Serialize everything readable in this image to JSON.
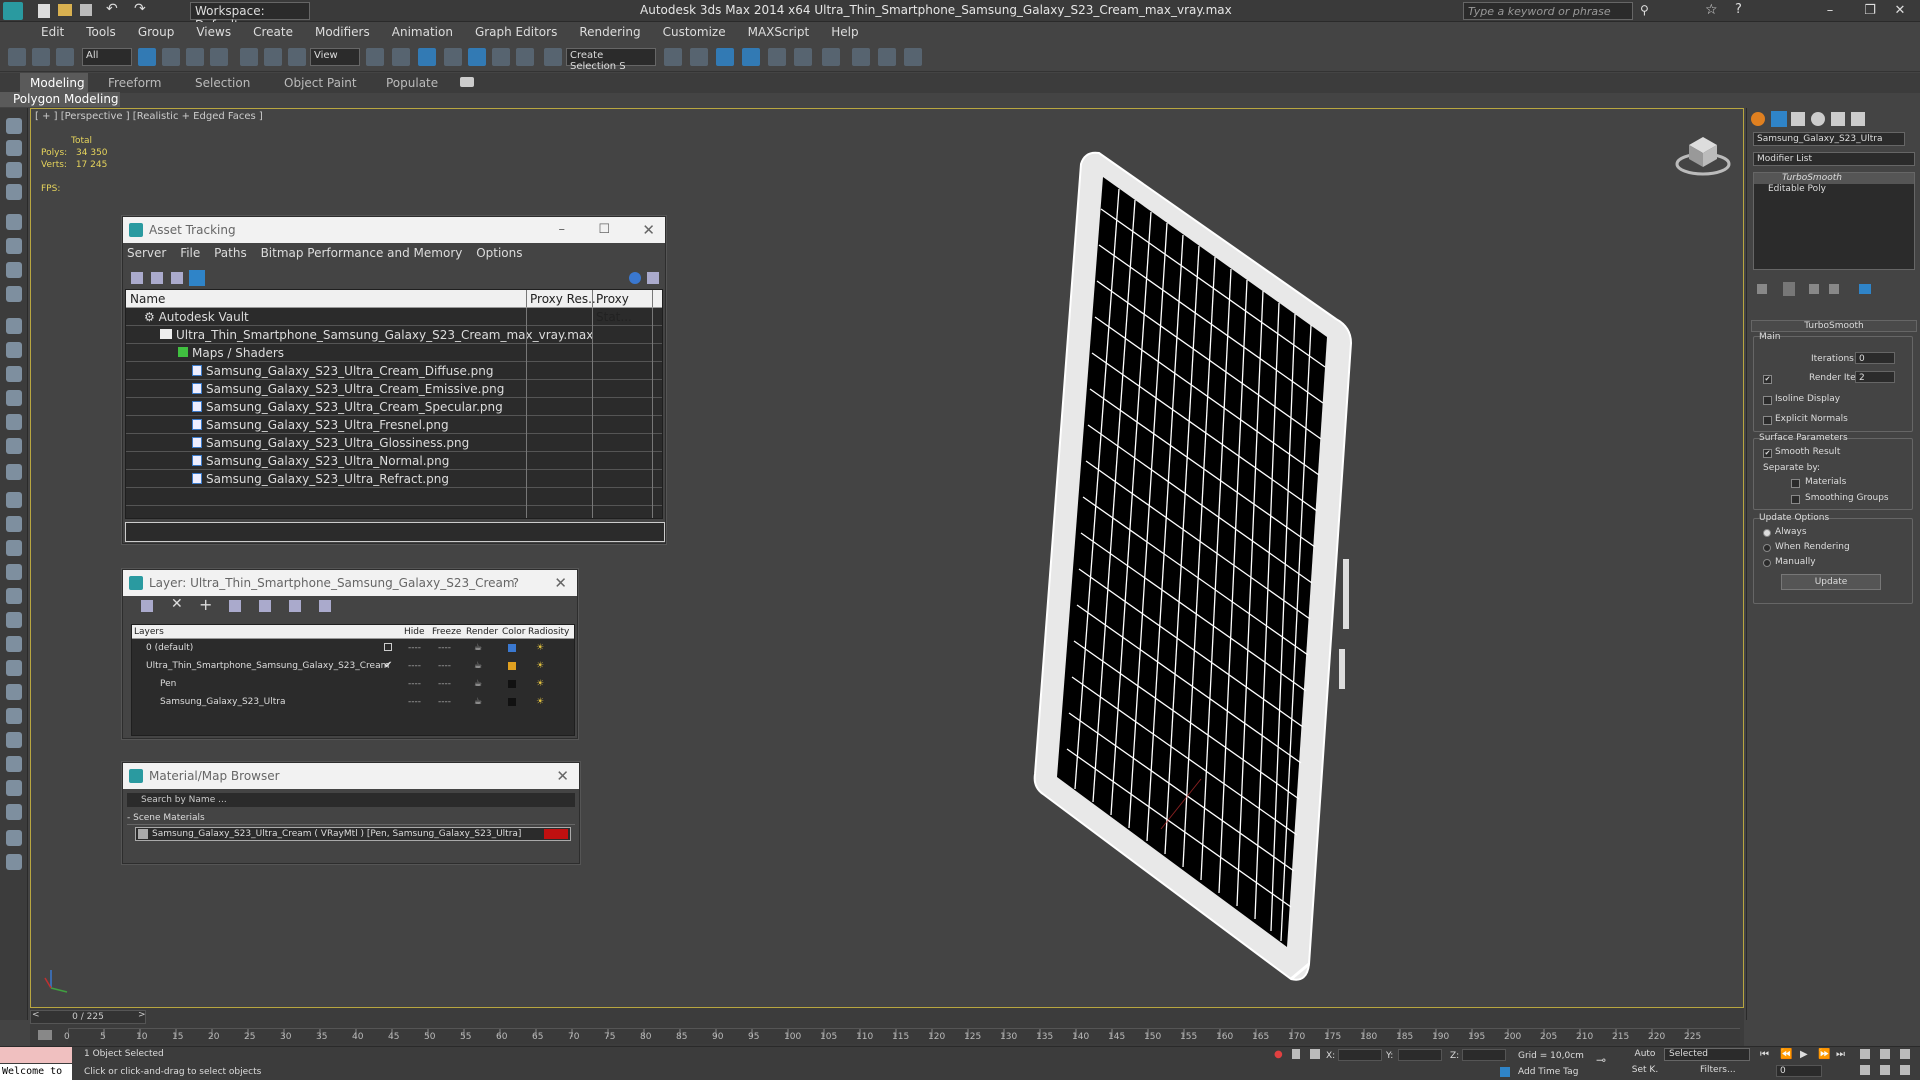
{
  "app": {
    "title": "Autodesk 3ds Max  2014 x64     Ultra_Thin_Smartphone_Samsung_Galaxy_S23_Cream_max_vray.max",
    "workspace": "Workspace: Default",
    "search_placeholder": "Type a keyword or phrase"
  },
  "menu": [
    "Edit",
    "Tools",
    "Group",
    "Views",
    "Create",
    "Modifiers",
    "Animation",
    "Graph Editors",
    "Rendering",
    "Customize",
    "MAXScript",
    "Help"
  ],
  "toolbar": {
    "filter": "All",
    "view": "View",
    "selset": "Create Selection S"
  },
  "ribbon": {
    "tabs": [
      "Modeling",
      "Freeform",
      "Selection",
      "Object Paint",
      "Populate"
    ],
    "sub": "Polygon Modeling"
  },
  "viewport": {
    "label": "[ + ] [Perspective ] [Realistic + Edged Faces ]",
    "stats": {
      "total": "Total",
      "polys_label": "Polys:",
      "polys": "34 350",
      "verts_label": "Verts:",
      "verts": "17 245",
      "fps": "FPS:"
    }
  },
  "asset_tracking": {
    "title": "Asset Tracking",
    "menu": [
      "Server",
      "File",
      "Paths",
      "Bitmap Performance and Memory",
      "Options"
    ],
    "columns": [
      "Name",
      "Proxy Res...",
      "Proxy Stat..."
    ],
    "vault": "Autodesk Vault",
    "maxfile": "Ultra_Thin_Smartphone_Samsung_Galaxy_S23_Cream_max_vray.max",
    "maps": "Maps / Shaders",
    "files": [
      "Samsung_Galaxy_S23_Ultra_Cream_Diffuse.png",
      "Samsung_Galaxy_S23_Ultra_Cream_Emissive.png",
      "Samsung_Galaxy_S23_Ultra_Cream_Specular.png",
      "Samsung_Galaxy_S23_Ultra_Fresnel.png",
      "Samsung_Galaxy_S23_Ultra_Glossiness.png",
      "Samsung_Galaxy_S23_Ultra_Normal.png",
      "Samsung_Galaxy_S23_Ultra_Refract.png"
    ]
  },
  "layer": {
    "title": "Layer: Ultra_Thin_Smartphone_Samsung_Galaxy_S23_Cream",
    "help": "?",
    "columns": [
      "Layers",
      "Hide",
      "Freeze",
      "Render",
      "Color",
      "Radiosity"
    ],
    "rows": [
      {
        "name": "0 (default)",
        "color": "#3a78d0"
      },
      {
        "name": "Ultra_Thin_Smartphone_Samsung_Galaxy_S23_Cream",
        "color": "#e0a020"
      },
      {
        "name": "Pen",
        "color": "#111111"
      },
      {
        "name": "Samsung_Galaxy_S23_Ultra",
        "color": "#111111"
      }
    ]
  },
  "material_browser": {
    "title": "Material/Map Browser",
    "search": "Search by Name ...",
    "section": "- Scene Materials",
    "item": "Samsung_Galaxy_S23_Ultra_Cream  ( VRayMtl )  [Pen, Samsung_Galaxy_S23_Ultra]"
  },
  "command_panel": {
    "object_name": "Samsung_Galaxy_S23_Ultra",
    "modifier_list": "Modifier List",
    "stack": [
      "TurboSmooth",
      "Editable Poly"
    ],
    "rollout": "TurboSmooth",
    "main": "Main",
    "iterations_label": "Iterations:",
    "iterations": "0",
    "render_iters_label": "Render Iters:",
    "render_iters": "2",
    "isoline": "Isoline Display",
    "explicit": "Explicit Normals",
    "surface": "Surface Parameters",
    "smooth": "Smooth Result",
    "separate": "Separate by:",
    "materials": "Materials",
    "smoothing": "Smoothing Groups",
    "update_opts": "Update Options",
    "always": "Always",
    "when_rendering": "When Rendering",
    "manually": "Manually",
    "update_btn": "Update"
  },
  "timeline": {
    "frame": "0 / 225",
    "ticks": [
      "0",
      "5",
      "10",
      "15",
      "20",
      "25",
      "30",
      "35",
      "40",
      "45",
      "50",
      "55",
      "60",
      "65",
      "70",
      "75",
      "80",
      "85",
      "90",
      "95",
      "100",
      "105",
      "110",
      "115",
      "120",
      "125",
      "130",
      "135",
      "140",
      "145",
      "150",
      "155",
      "160",
      "165",
      "170",
      "175",
      "180",
      "185",
      "190",
      "195",
      "200",
      "205",
      "210",
      "215",
      "220",
      "225"
    ]
  },
  "status": {
    "welcome": "Welcome to",
    "selected": "1 Object Selected",
    "hint": "Click or click-and-drag to select objects",
    "x": "X:",
    "y": "Y:",
    "z": "Z:",
    "grid": "Grid = 10,0cm",
    "auto": "Auto",
    "selected_dd": "Selected",
    "setk": "Set K.",
    "filters": "Filters...",
    "addtime": "Add Time Tag",
    "frame": "0"
  }
}
